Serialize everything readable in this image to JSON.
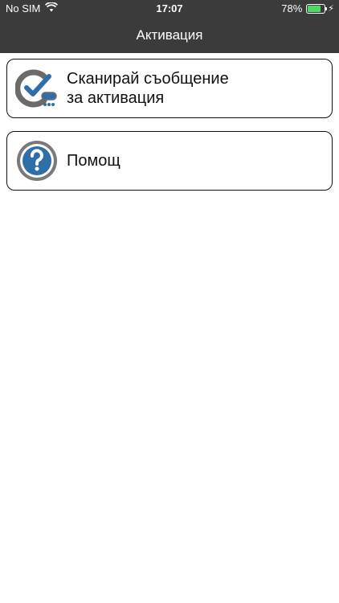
{
  "status_bar": {
    "carrier": "No SIM",
    "time": "17:07",
    "battery_percent": "78%",
    "battery_level": 0.78,
    "wifi_icon": "wifi-icon",
    "charging_icon": "bolt-icon"
  },
  "nav": {
    "title": "Активация"
  },
  "menu": {
    "items": [
      {
        "label": "Сканирай съобщение\nза активация",
        "icon": "scan-check-icon"
      },
      {
        "label": "Помощ",
        "icon": "help-question-icon"
      }
    ]
  },
  "colors": {
    "header_bg": "#3b3b3b",
    "icon_blue": "#2f6fa8",
    "icon_gray": "#6b6b6b",
    "battery_green": "#4cd964"
  }
}
